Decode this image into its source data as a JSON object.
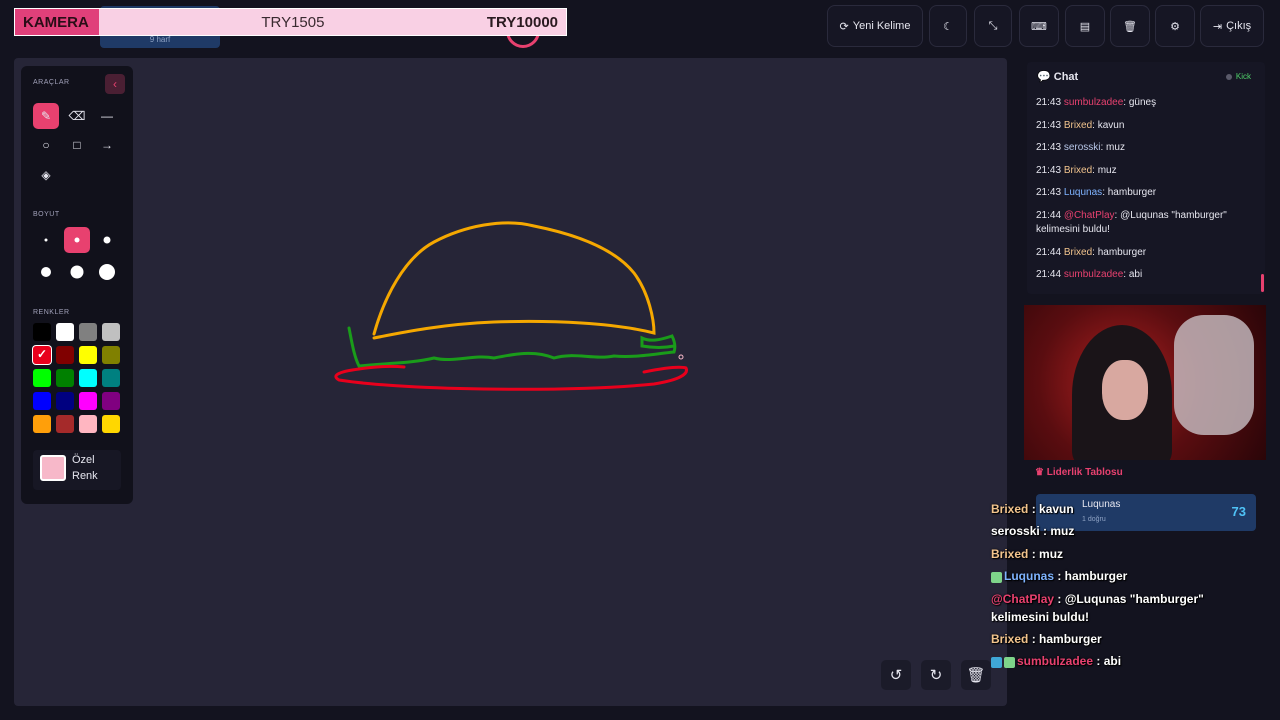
{
  "overlay": {
    "camera_label": "KAMERA",
    "mid_text": "TRY1505",
    "right_text": "TRY10000"
  },
  "word_hint": "9 harf",
  "toolbar": {
    "new_word": "Yeni Kelime",
    "exit": "Çıkış",
    "icons": [
      "moon-icon",
      "compress-icon",
      "keyboard-icon",
      "archive-icon",
      "trash-icon",
      "gear-icon"
    ]
  },
  "tools_panel": {
    "tools_title": "ARAÇLAR",
    "size_title": "BOYUT",
    "colors_title": "RENKLER",
    "custom_color": "Özel Renk",
    "colors": [
      "#000000",
      "#ffffff",
      "#808080",
      "#c0c0c0",
      "#e8001c",
      "#800000",
      "#ffff00",
      "#808000",
      "#00ff00",
      "#008000",
      "#00ffff",
      "#008080",
      "#0000ff",
      "#000080",
      "#ff00ff",
      "#800080",
      "#ff9f0a",
      "#a52a2a",
      "#ffb6c1",
      "#ffd700"
    ],
    "selected_color": "#e8001c"
  },
  "chat": {
    "title": "Chat",
    "kick_label": "Kick",
    "messages": [
      {
        "time": "21:43",
        "user": "sumbulzadee",
        "color": "#e8416f",
        "text": ": güneş"
      },
      {
        "time": "21:43",
        "user": "Brixed",
        "color": "#f2c48d",
        "text": ": kavun"
      },
      {
        "time": "21:43",
        "user": "serosski",
        "color": "#b8c7e8",
        "text": ": muz"
      },
      {
        "time": "21:43",
        "user": "Brixed",
        "color": "#f2c48d",
        "text": ": muz"
      },
      {
        "time": "21:43",
        "user": "Luqunas",
        "color": "#7fb3ff",
        "text": ": hamburger"
      },
      {
        "time": "21:44",
        "user": "@ChatPlay",
        "color": "#e8416f",
        "text": ": @Luqunas \"hamburger\" kelimesini buldu!"
      },
      {
        "time": "21:44",
        "user": "Brixed",
        "color": "#f2c48d",
        "text": ": hamburger"
      },
      {
        "time": "21:44",
        "user": "sumbulzadee",
        "color": "#e8416f",
        "text": ": abi"
      }
    ]
  },
  "leaderboard": {
    "title": "Liderlik Tablosu",
    "rows": [
      {
        "name": "Luqunas",
        "sub": "1 doğru",
        "score": "73"
      }
    ]
  },
  "overlay_chat": [
    {
      "user": "Brixed",
      "color": "#f2c48d",
      "text": " : kavun",
      "badge": ""
    },
    {
      "user": "serosski",
      "color": "#ffffff",
      "text": " : muz",
      "badge": ""
    },
    {
      "user": "Brixed",
      "color": "#f2c48d",
      "text": " : muz",
      "badge": ""
    },
    {
      "user": "Luqunas",
      "color": "#7fb3ff",
      "text": " : hamburger",
      "badge": "g"
    },
    {
      "user": "@ChatPlay",
      "color": "#e8416f",
      "text": " : @Luqunas \"hamburger\" kelimesini buldu!",
      "badge": ""
    },
    {
      "user": "Brixed",
      "color": "#f2c48d",
      "text": " : hamburger",
      "badge": ""
    },
    {
      "user": "sumbulzadee",
      "color": "#e8416f",
      "text": " : abi",
      "badge": "bg"
    }
  ]
}
